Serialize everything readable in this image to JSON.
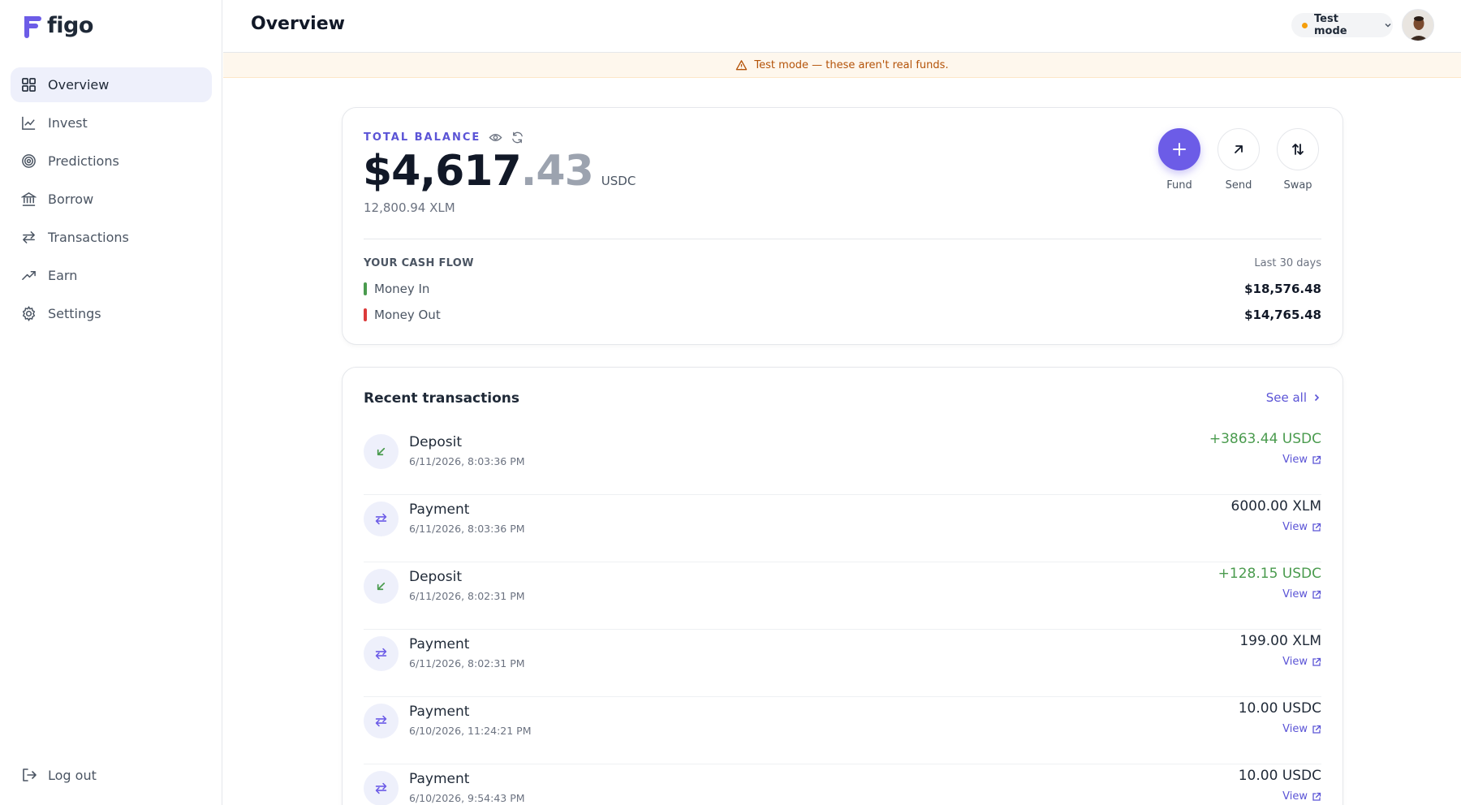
{
  "app": {
    "name": "figo"
  },
  "sidebar": {
    "items": [
      {
        "label": "Overview",
        "icon": "grid-icon",
        "active": true
      },
      {
        "label": "Invest",
        "icon": "chart-line-icon"
      },
      {
        "label": "Predictions",
        "icon": "target-icon"
      },
      {
        "label": "Borrow",
        "icon": "bank-icon"
      },
      {
        "label": "Transactions",
        "icon": "arrows-exchange-icon"
      },
      {
        "label": "Earn",
        "icon": "trending-up-icon"
      },
      {
        "label": "Settings",
        "icon": "gear-icon"
      }
    ],
    "logout_label": "Log out"
  },
  "header": {
    "title": "Overview",
    "mode_label": "Test mode"
  },
  "banner": {
    "text": "Test mode — these aren't real funds."
  },
  "balance": {
    "label": "TOTAL BALANCE",
    "amount_int": "$4,617",
    "amount_dec": ".43",
    "unit": "USDC",
    "secondary": "12,800.94 XLM"
  },
  "actions": [
    {
      "label": "Fund",
      "icon": "plus-icon"
    },
    {
      "label": "Send",
      "icon": "arrow-up-right-icon"
    },
    {
      "label": "Swap",
      "icon": "swap-vertical-icon"
    }
  ],
  "cashflow": {
    "title": "YOUR CASH FLOW",
    "period": "Last 30 days",
    "in_label": "Money In",
    "in_value": "$18,576.48",
    "out_label": "Money Out",
    "out_value": "$14,765.48"
  },
  "transactions": {
    "title": "Recent transactions",
    "see_all": "See all",
    "view_label": "View",
    "items": [
      {
        "type": "Deposit",
        "date": "6/11/2026, 8:03:36 PM",
        "amount": "+3863.44 USDC",
        "positive": true
      },
      {
        "type": "Payment",
        "date": "6/11/2026, 8:03:36 PM",
        "amount": "6000.00 XLM",
        "positive": false
      },
      {
        "type": "Deposit",
        "date": "6/11/2026, 8:02:31 PM",
        "amount": "+128.15 USDC",
        "positive": true
      },
      {
        "type": "Payment",
        "date": "6/11/2026, 8:02:31 PM",
        "amount": "199.00 XLM",
        "positive": false
      },
      {
        "type": "Payment",
        "date": "6/10/2026, 11:24:21 PM",
        "amount": "10.00 USDC",
        "positive": false
      },
      {
        "type": "Payment",
        "date": "6/10/2026, 9:54:43 PM",
        "amount": "10.00 USDC",
        "positive": false
      }
    ]
  },
  "colors": {
    "accent": "#6c5ce7",
    "positive": "#4a9b4e",
    "negative": "#dc3a3a",
    "warning": "#f59e0b"
  }
}
